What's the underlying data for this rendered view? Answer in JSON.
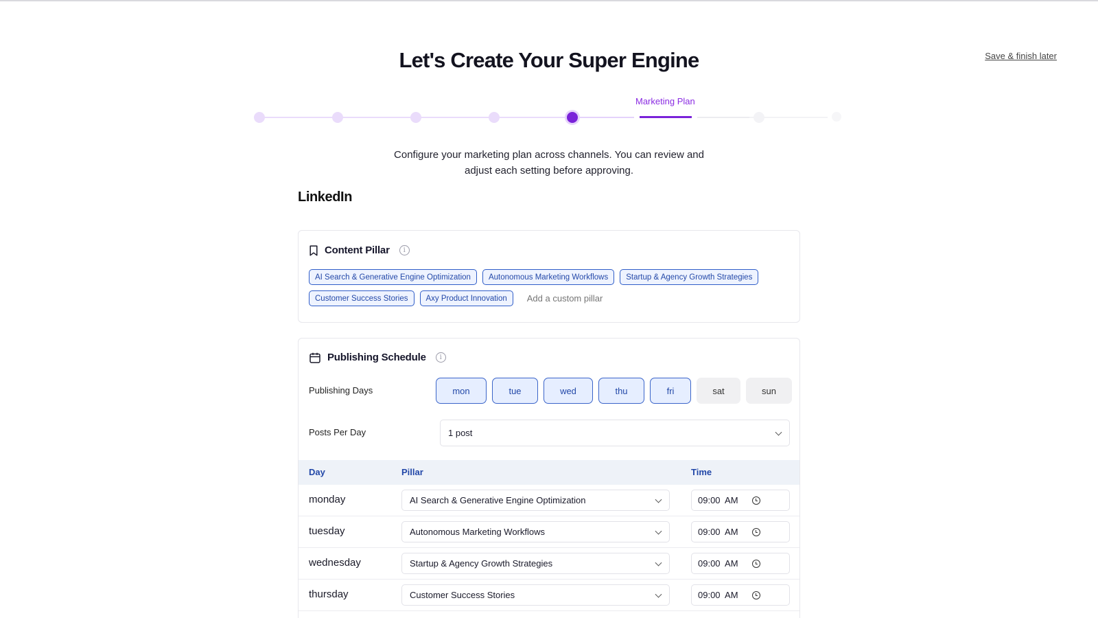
{
  "page": {
    "title": "Let's Create Your Super Engine",
    "save_later": "Save & finish later",
    "intro_line1": "Configure your marketing plan across channels. You can review and",
    "intro_line2": "adjust each setting before approving."
  },
  "stepper": {
    "current_label": "Marketing Plan",
    "total_steps": 8,
    "current_step": 6,
    "colors": {
      "done": "#e9d8fb",
      "active": "#7a22d9",
      "future": "#f0f0f3"
    }
  },
  "channel": {
    "name": "LinkedIn"
  },
  "content_pillar": {
    "title": "Content Pillar",
    "info_icon": "info-icon",
    "icon": "bookmark-icon",
    "chips": [
      "AI Search & Generative Engine Optimization",
      "Autonomous Marketing Workflows",
      "Startup & Agency Growth Strategies",
      "Customer Success Stories",
      "Axy Product Innovation"
    ],
    "custom_placeholder": "Add a custom pillar"
  },
  "schedule": {
    "title": "Publishing Schedule",
    "icon": "calendar-icon",
    "days_label": "Publishing Days",
    "days": [
      {
        "label": "mon",
        "selected": true
      },
      {
        "label": "tue",
        "selected": true
      },
      {
        "label": "wed",
        "selected": true
      },
      {
        "label": "thu",
        "selected": true
      },
      {
        "label": "fri",
        "selected": true
      },
      {
        "label": "sat",
        "selected": false
      },
      {
        "label": "sun",
        "selected": false
      }
    ],
    "posts_label": "Posts Per Day",
    "posts_value": "1 post",
    "columns": {
      "day": "Day",
      "pillar": "Pillar",
      "time": "Time"
    },
    "rows": [
      {
        "day": "monday",
        "pillar": "AI Search & Generative Engine Optimization",
        "time": "09:00  AM"
      },
      {
        "day": "tuesday",
        "pillar": "Autonomous Marketing Workflows",
        "time": "09:00  AM"
      },
      {
        "day": "wednesday",
        "pillar": "Startup & Agency Growth Strategies",
        "time": "09:00  AM"
      },
      {
        "day": "thursday",
        "pillar": "Customer Success Stories",
        "time": "09:00  AM"
      }
    ]
  },
  "colors": {
    "accent_purple": "#7a22d9",
    "chip_blue": "#2348a8",
    "chip_bg": "#eef3ff"
  }
}
